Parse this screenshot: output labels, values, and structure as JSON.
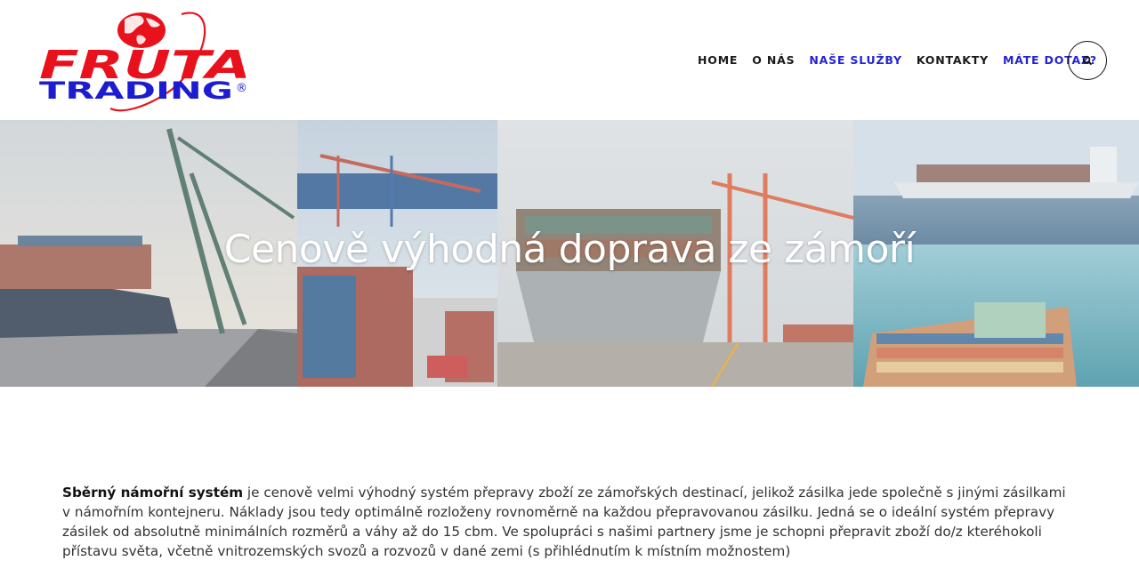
{
  "logo": {
    "word_top": "FRUTA",
    "word_bottom": "TRADING",
    "mark": "®"
  },
  "nav": {
    "items": [
      {
        "label": "HOME",
        "accent": false
      },
      {
        "label": "O NÁS",
        "accent": false
      },
      {
        "label": "NAŠE SLUŽBY",
        "accent": true
      },
      {
        "label": "KONTAKTY",
        "accent": false
      },
      {
        "label": "MÁTE DOTAZ?",
        "accent": true
      }
    ]
  },
  "hero": {
    "title": "Cenově výhodná doprava ze zámoří"
  },
  "intro": {
    "lead": "Sběrný námořní systém",
    "text": " je cenově velmi výhodný systém přepravy zboží ze zámořských destinací, jelikož zásilka jede společně s jinými zásilkami v námořním kontejneru. Náklady jsou tedy optimálně rozloženy rovnoměrně na každou přepravovanou zásilku. Jedná se o ideální systém přepravy zásilek od absolutně minimálních rozměrů a váhy až do 15 cbm. Ve spolupráci s našimi partnery jsme je schopni přepravit zboží do/z kteréhokoli přístavu světa, včetně vnitrozemských svozů a rozvozů v dané zemi (s přihlédnutím k místním možnostem)"
  },
  "colors": {
    "accent": "#2323d6",
    "logo_red": "#e8111c",
    "logo_blue": "#1c1cd0"
  },
  "icons": {
    "search": "search-icon"
  }
}
